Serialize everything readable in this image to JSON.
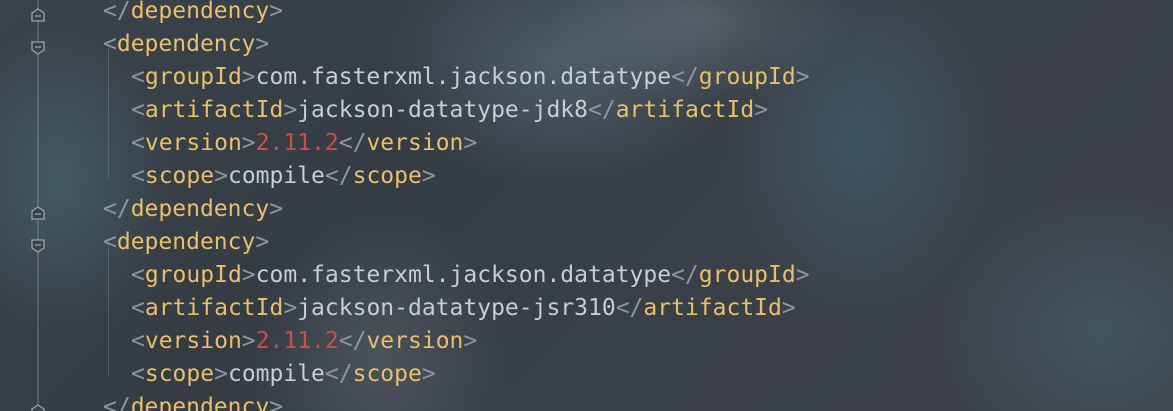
{
  "editor": {
    "lines": [
      {
        "indent": 0,
        "kind": "close",
        "tag": "dependency"
      },
      {
        "indent": 0,
        "kind": "open",
        "tag": "dependency"
      },
      {
        "indent": 1,
        "kind": "element",
        "tag": "groupId",
        "value": "com.fasterxml.jackson.datatype",
        "value_type": "text"
      },
      {
        "indent": 1,
        "kind": "element",
        "tag": "artifactId",
        "value": "jackson-datatype-jdk8",
        "value_type": "text"
      },
      {
        "indent": 1,
        "kind": "element",
        "tag": "version",
        "value": "2.11.2",
        "value_type": "number"
      },
      {
        "indent": 1,
        "kind": "element",
        "tag": "scope",
        "value": "compile",
        "value_type": "text"
      },
      {
        "indent": 0,
        "kind": "close",
        "tag": "dependency"
      },
      {
        "indent": 0,
        "kind": "open",
        "tag": "dependency"
      },
      {
        "indent": 1,
        "kind": "element",
        "tag": "groupId",
        "value": "com.fasterxml.jackson.datatype",
        "value_type": "text"
      },
      {
        "indent": 1,
        "kind": "element",
        "tag": "artifactId",
        "value": "jackson-datatype-jsr310",
        "value_type": "text"
      },
      {
        "indent": 1,
        "kind": "element",
        "tag": "version",
        "value": "2.11.2",
        "value_type": "number"
      },
      {
        "indent": 1,
        "kind": "element",
        "tag": "scope",
        "value": "compile",
        "value_type": "text"
      },
      {
        "indent": 0,
        "kind": "close",
        "tag": "dependency"
      }
    ],
    "gutter": {
      "fold_markers": [
        {
          "line": 0,
          "icon": "fold-end-icon"
        },
        {
          "line": 1,
          "icon": "fold-start-icon"
        },
        {
          "line": 6,
          "icon": "fold-end-icon"
        },
        {
          "line": 7,
          "icon": "fold-start-icon"
        },
        {
          "line": 12,
          "icon": "fold-end-icon"
        }
      ]
    },
    "colors": {
      "bracket": "#8b98a3",
      "tag": "#e8bf6a",
      "text": "#c9ccd0",
      "number": "#c9504a"
    }
  }
}
